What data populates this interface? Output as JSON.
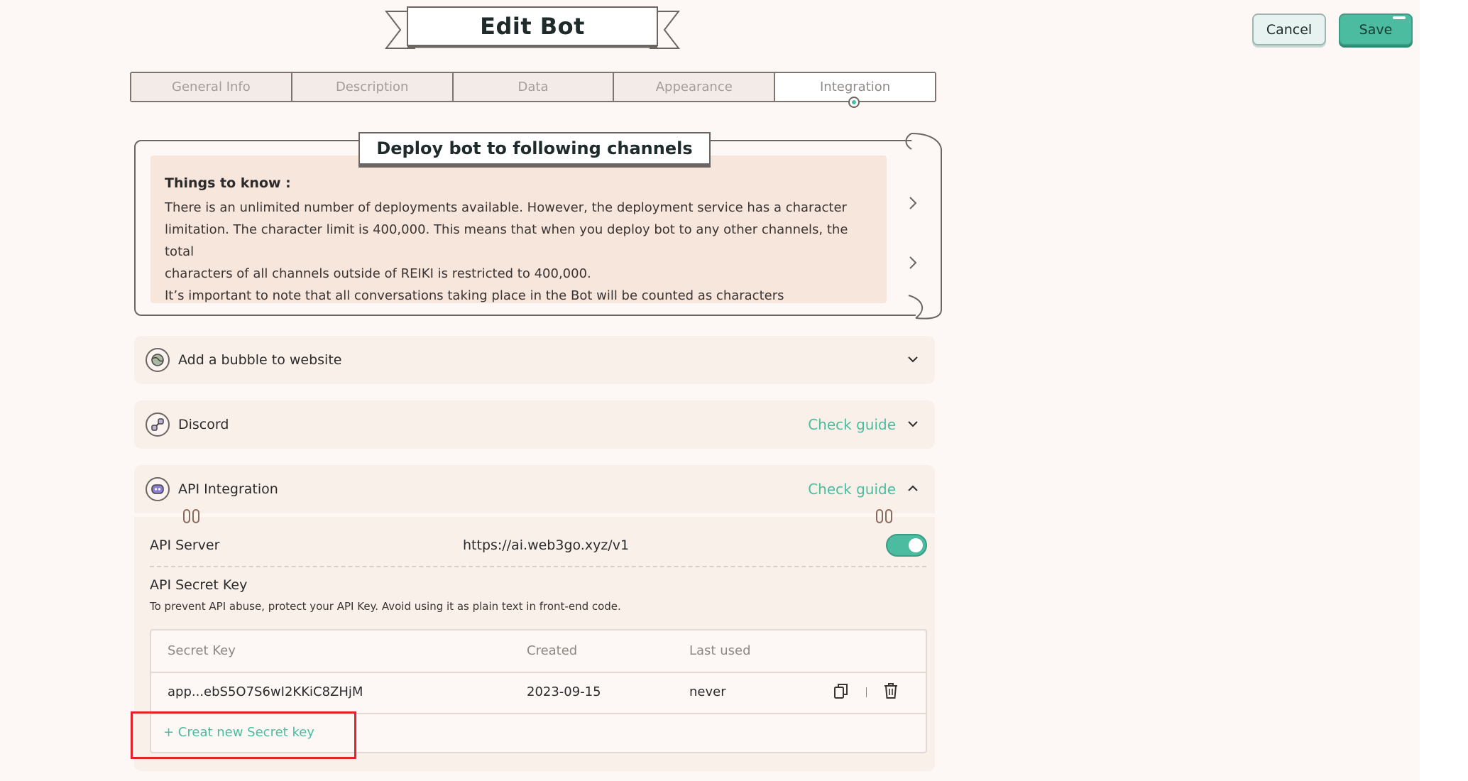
{
  "header": {
    "title": "Edit Bot",
    "cancel_label": "Cancel",
    "save_label": "Save"
  },
  "tabs": [
    {
      "label": "General Info"
    },
    {
      "label": "Description"
    },
    {
      "label": "Data"
    },
    {
      "label": "Appearance"
    },
    {
      "label": "Integration",
      "active": true
    }
  ],
  "deploy": {
    "banner": "Deploy bot to following channels",
    "know_title": "Things to know :",
    "lines": [
      "There is an unlimited number of deployments available. However, the deployment service has a character",
      "limitation. The character limit is 400,000. This means that when you deploy bot to any other channels, the total",
      "characters of all channels outside of REIKI is restricted to 400,000.",
      "It’s important to note that all conversations taking place in the Bot will be counted as characters"
    ]
  },
  "channels": {
    "bubble": {
      "label": "Add a bubble to website"
    },
    "discord": {
      "label": "Discord",
      "guide": "Check guide"
    },
    "api": {
      "label": "API Integration",
      "guide": "Check guide"
    }
  },
  "api": {
    "server_label": "API Server",
    "server_url": "https://ai.web3go.xyz/v1",
    "server_enabled": true,
    "secret_title": "API Secret Key",
    "secret_desc": "To prevent API abuse, protect your API Key. Avoid using it as plain text in front-end code.",
    "table": {
      "headers": [
        "Secret Key",
        "Created",
        "Last used"
      ],
      "rows": [
        {
          "key": "app...ebS5O7S6wI2KKiC8ZHjM",
          "created": "2023-09-15",
          "last_used": "never"
        }
      ]
    },
    "create_label": "+ Creat new Secret key"
  },
  "colors": {
    "accent": "#4bbc9f",
    "background": "#fdf8f5",
    "highlight": "#e8202a"
  },
  "icons": {
    "copy": "copy-icon",
    "delete": "trash-icon",
    "bubble": "globe-icon",
    "discord": "link-icon",
    "api": "discord-logo-icon"
  }
}
